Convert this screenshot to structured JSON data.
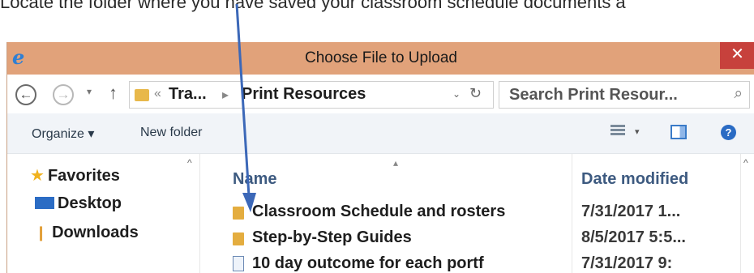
{
  "instruction_text": "Locate the folder where you have saved your classroom schedule documents a",
  "window": {
    "title": "Choose File to Upload",
    "close_glyph": "✕"
  },
  "address": {
    "back_glyph": "←",
    "forward_glyph": "→",
    "recent_glyph": "▾",
    "up_glyph": "↑",
    "sep1": "«",
    "crumb_parent": "Tra...",
    "sep2": "▸",
    "crumb_current": "Print Resources",
    "drop_glyph": "⌄",
    "refresh_glyph": "↻",
    "search_placeholder": "Search Print Resour...",
    "search_glyph": "⌕"
  },
  "commandbar": {
    "organize_label": "Organize ▾",
    "new_folder_label": "New folder",
    "view_drop_glyph": "▾",
    "help_glyph": "?"
  },
  "navpane": {
    "scroll_up_glyph": "^",
    "favorites": {
      "icon": "star-icon",
      "glyph": "★",
      "label": "Favorites"
    },
    "desktop": {
      "icon": "desktop-icon",
      "label": "Desktop"
    },
    "downloads": {
      "icon": "downloads-icon",
      "glyph": "❙",
      "label": "Downloads"
    }
  },
  "filelist": {
    "sort_glyph": "▴",
    "scroll_glyph": "^",
    "columns": {
      "name": "Name",
      "date": "Date modified"
    },
    "rows": [
      {
        "icon": "folder-icon",
        "name": "Classroom Schedule and rosters",
        "date": "7/31/2017 1..."
      },
      {
        "icon": "folder-icon",
        "name": "Step-by-Step Guides",
        "date": "8/5/2017 5:5..."
      },
      {
        "icon": "document-icon",
        "name": "10 day outcome for each portf",
        "date": "7/31/2017 9:"
      }
    ]
  },
  "colors": {
    "titlebar": "#e1a27a",
    "close": "#c7413c",
    "arrow": "#3c68b8",
    "folder": "#e4ad3f",
    "header_text": "#3d5a80"
  }
}
